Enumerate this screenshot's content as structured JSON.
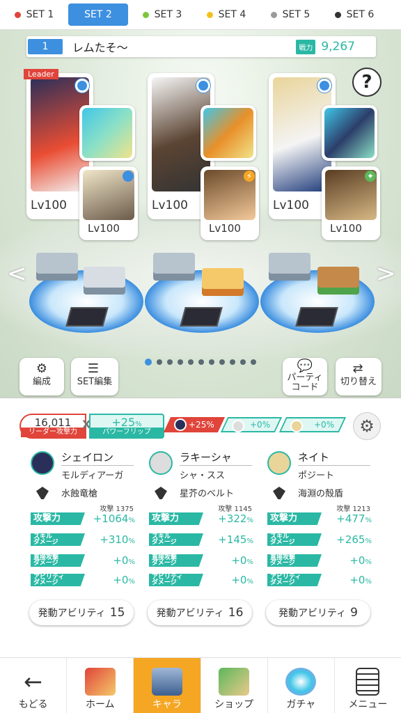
{
  "tabs": [
    {
      "label": "SET 1",
      "color": "#e0443a"
    },
    {
      "label": "SET 2",
      "color": "#ffffff",
      "active": true
    },
    {
      "label": "SET 3",
      "color": "#7cc63d"
    },
    {
      "label": "SET 4",
      "color": "#f2c21b"
    },
    {
      "label": "SET 5",
      "color": "#9a9a9a"
    },
    {
      "label": "SET 6",
      "color": "#333333"
    }
  ],
  "party": {
    "number": "1",
    "name": "レムたそ〜",
    "power_label": "戦力",
    "power": "9,267"
  },
  "help": "?",
  "leader_tag": "Leader",
  "cards": [
    {
      "lv": "Lv100",
      "sub_lv": "Lv100"
    },
    {
      "lv": "Lv100",
      "sub_lv": "Lv100"
    },
    {
      "lv": "Lv100",
      "sub_lv": "Lv100"
    }
  ],
  "nav_arrows": {
    "left": "<",
    "right": ">"
  },
  "page_dots": {
    "count": 11,
    "active": 0
  },
  "tools": {
    "edit": "編成",
    "set_edit": "SET編集",
    "party_code": "パーティ\nコード",
    "switch": "切り替え"
  },
  "summary": {
    "leader_value": "16,011",
    "leader_label": "リーダー攻撃力",
    "times": "X",
    "powerflip_value": "+25",
    "powerflip_unit": "%",
    "powerflip_label": "パワーフリップ",
    "boosts": [
      {
        "value": "+25%",
        "color": "#e0443a"
      },
      {
        "value": "+0%",
        "color": "#2ab8a4"
      },
      {
        "value": "+0%",
        "color": "#2ab8a4"
      }
    ]
  },
  "characters": [
    {
      "name": "シェイロン",
      "sub": "モルディアーガ",
      "weapon": "水蝕竜槍",
      "attack_label": "攻撃力",
      "attack_raw": "攻撃 1375",
      "attack": "+1064",
      "skill_label": "スキル\nダメージ",
      "skill": "+310",
      "direct_label": "直接攻撃\nダメージ",
      "direct": "+0",
      "ability_label": "アビリティ\nダメージ",
      "ability": "+0",
      "ability_count_label": "発動アビリティ",
      "ability_count": "15"
    },
    {
      "name": "ラキーシャ",
      "sub": "シャ・スス",
      "weapon": "星芥のベルト",
      "attack_label": "攻撃力",
      "attack_raw": "攻撃 1145",
      "attack": "+322",
      "skill_label": "スキル\nダメージ",
      "skill": "+145",
      "direct_label": "直接攻撃\nダメージ",
      "direct": "+0",
      "ability_label": "アビリティ\nダメージ",
      "ability": "+0",
      "ability_count_label": "発動アビリティ",
      "ability_count": "16"
    },
    {
      "name": "ネイト",
      "sub": "ポジート",
      "weapon": "海淵の殻盾",
      "attack_label": "攻撃力",
      "attack_raw": "攻撃 1213",
      "attack": "+477",
      "skill_label": "スキル\nダメージ",
      "skill": "+265",
      "direct_label": "直接攻撃\nダメージ",
      "direct": "+0",
      "ability_label": "アビリティ\nダメージ",
      "ability": "+0",
      "ability_count_label": "発動アビリティ",
      "ability_count": "9"
    }
  ],
  "percent": "%",
  "bottom_nav": [
    {
      "label": "もどる"
    },
    {
      "label": "ホーム"
    },
    {
      "label": "キャラ",
      "active": true
    },
    {
      "label": "ショップ"
    },
    {
      "label": "ガチャ"
    },
    {
      "label": "メニュー"
    }
  ]
}
